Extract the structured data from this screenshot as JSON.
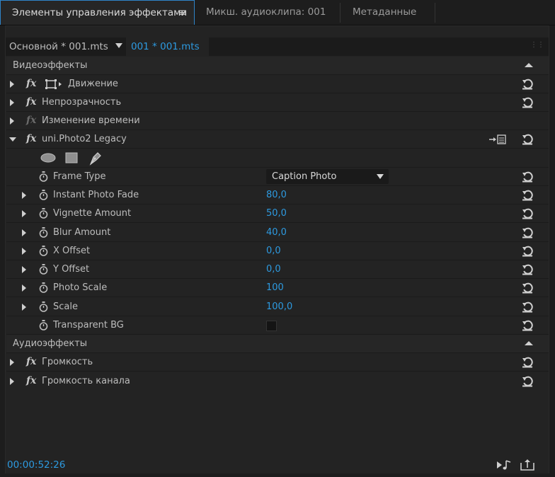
{
  "tabs": [
    {
      "label": "Элементы управления эффектами",
      "active": true
    },
    {
      "label": "Микш. аудиоклипа: 001",
      "active": false
    },
    {
      "label": "Метаданные",
      "active": false
    }
  ],
  "clip_tabs": {
    "master": "Основной * 001.mts",
    "current": "001 * 001.mts"
  },
  "video_section": {
    "label": "Видеоэффекты"
  },
  "effects": [
    {
      "label": "Движение",
      "enabled": true
    },
    {
      "label": "Непрозрачность",
      "enabled": true
    },
    {
      "label": "Изменение времени",
      "enabled": false
    },
    {
      "label": "uni.Photo2 Legacy",
      "enabled": true
    }
  ],
  "params": [
    {
      "label": "Frame Type",
      "value": "Caption Photo",
      "kind": "dropdown"
    },
    {
      "label": "Instant Photo Fade",
      "value": "80,0"
    },
    {
      "label": "Vignette Amount",
      "value": "50,0"
    },
    {
      "label": "Blur Amount",
      "value": "40,0"
    },
    {
      "label": "X Offset",
      "value": "0,0"
    },
    {
      "label": "Y Offset",
      "value": "0,0"
    },
    {
      "label": "Photo Scale",
      "value": "100"
    },
    {
      "label": "Scale",
      "value": "100,0"
    },
    {
      "label": "Transparent BG",
      "value": false,
      "kind": "checkbox"
    }
  ],
  "audio_section": {
    "label": "Аудиоэффекты"
  },
  "audio_effects": [
    {
      "label": "Громкость"
    },
    {
      "label": "Громкость канала"
    }
  ],
  "footer": {
    "timecode": "00:00:52:26"
  },
  "colors": {
    "accent": "#2d9ae0",
    "active_tab_border": "#2f84c8",
    "background": "#232323"
  },
  "icons": {
    "reset": "reset-icon",
    "stopwatch": "stopwatch-icon",
    "fx": "fx-badge-icon",
    "ellipse_mask": "ellipse-mask-icon",
    "rect_mask": "rectangle-mask-icon",
    "pen_mask": "pen-mask-icon"
  }
}
